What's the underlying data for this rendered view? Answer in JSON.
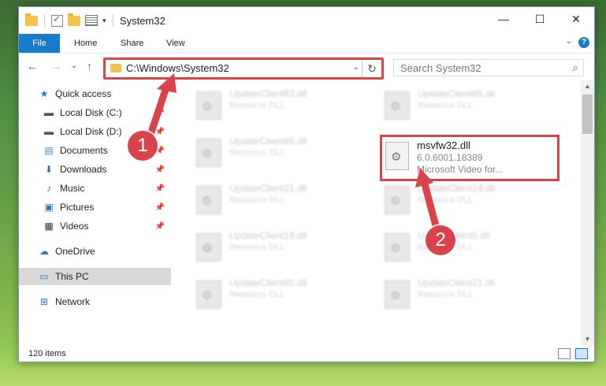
{
  "window": {
    "title": "System32",
    "controls": {
      "minimize": "—",
      "maximize": "☐",
      "close": "✕"
    }
  },
  "ribbon": {
    "tabs": [
      "File",
      "Home",
      "Share",
      "View"
    ],
    "expand": "⌄",
    "help": "?"
  },
  "navbar": {
    "back": "←",
    "forward": "→",
    "recent": "⌄",
    "up": "↑",
    "address": "C:\\Windows\\System32",
    "refresh": "↻",
    "dropdown": "⌄",
    "search_placeholder": "Search System32",
    "search_icon": "search-icon"
  },
  "sidebar": {
    "items": [
      {
        "label": "Quick access",
        "icon": "star-icon",
        "pinned": false
      },
      {
        "label": "Local Disk (C:)",
        "icon": "drive-icon",
        "pinned": true
      },
      {
        "label": "Local Disk (D:)",
        "icon": "drive-icon",
        "pinned": true
      },
      {
        "label": "Documents",
        "icon": "documents-icon",
        "pinned": true
      },
      {
        "label": "Downloads",
        "icon": "downloads-icon",
        "pinned": true
      },
      {
        "label": "Music",
        "icon": "music-icon",
        "pinned": true
      },
      {
        "label": "Pictures",
        "icon": "pictures-icon",
        "pinned": true
      },
      {
        "label": "Videos",
        "icon": "videos-icon",
        "pinned": true
      },
      {
        "label": "OneDrive",
        "icon": "cloud-icon",
        "pinned": false
      },
      {
        "label": "This PC",
        "icon": "computer-icon",
        "pinned": false,
        "selected": true
      },
      {
        "label": "Network",
        "icon": "network-icon",
        "pinned": false
      }
    ]
  },
  "files": {
    "left_column": [
      {
        "name": "UpdateClient63.dll",
        "desc": "Resource DLL"
      },
      {
        "name": "UpdateClient65.dll",
        "desc": "Resource DLL"
      },
      {
        "name": "UpdateClient21.dll",
        "desc": "Resource DLL"
      },
      {
        "name": "UpdateClient19.dll",
        "desc": "Resource DLL"
      },
      {
        "name": "UpdateClient65.dll",
        "desc": "Resource DLL"
      }
    ],
    "right_column": [
      {
        "name": "UpdateClient65.dll",
        "desc": "Resource DLL"
      },
      {
        "name": "UpdateClient19.dll",
        "desc": "Resource DLL"
      },
      {
        "name": "UpdateClient5.dll",
        "desc": "Resource DLL"
      },
      {
        "name": "UpdateClient21.dll",
        "desc": "Resource DLL"
      }
    ],
    "highlighted": {
      "name": "msvfw32.dll",
      "version": "6.0.6001.18389",
      "desc": "Microsoft Video for..."
    }
  },
  "status": {
    "count": "120 items"
  },
  "annotations": {
    "step1": "1",
    "step2": "2",
    "color": "#d9444a"
  }
}
